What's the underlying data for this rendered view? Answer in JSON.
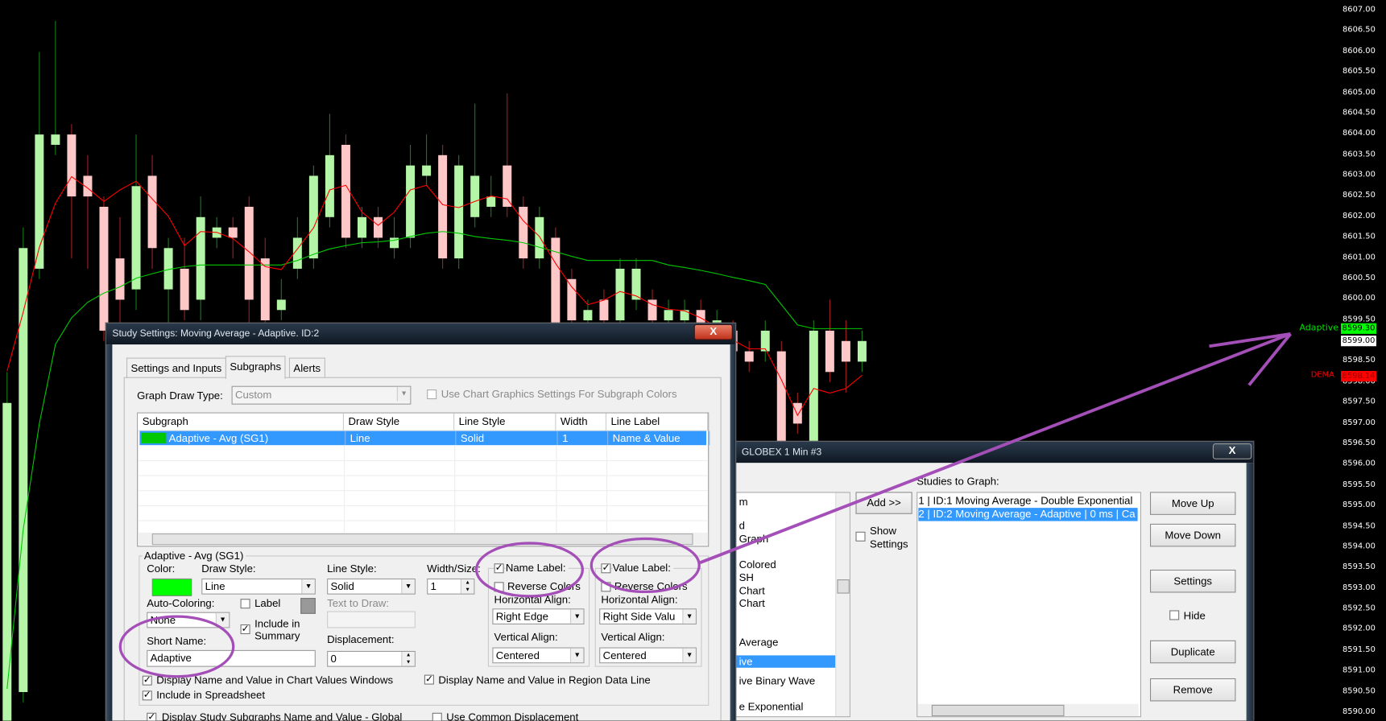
{
  "chart": {
    "price_ticks": [
      "8607.00",
      "8606.50",
      "8606.00",
      "8605.50",
      "8605.00",
      "8604.50",
      "8604.00",
      "8603.50",
      "8603.00",
      "8602.50",
      "8602.00",
      "8601.50",
      "8601.00",
      "8600.50",
      "8600.00",
      "8599.50",
      "8599.00",
      "8598.50",
      "8598.00",
      "8597.50",
      "8597.00",
      "8596.50",
      "8596.00",
      "8595.50",
      "8595.00",
      "8594.50",
      "8594.00",
      "8593.50",
      "8593.00",
      "8592.50",
      "8592.00",
      "8591.50",
      "8591.00",
      "8590.50",
      "8590.00"
    ],
    "colors": {
      "up": "#b4f5a8",
      "down": "#ffc8c8",
      "adaptive": "#00c800",
      "dema": "#ff0000",
      "annotation": "#a44fb8"
    },
    "candles": [
      [
        8589.75,
        8598.25,
        8589.5,
        8597.5
      ],
      [
        8590.5,
        8601.75,
        8590.25,
        8601.25
      ],
      [
        8600.75,
        8606,
        8600.5,
        8604
      ],
      [
        8603.75,
        8606.75,
        8603.5,
        8604
      ],
      [
        8604,
        8604.25,
        8601,
        8602.5
      ],
      [
        8603,
        8603.5,
        8600.75,
        8602.5
      ],
      [
        8602.25,
        8602.5,
        8599,
        8599.25
      ],
      [
        8601,
        8602,
        8599,
        8600
      ],
      [
        8600.25,
        8604,
        8599.75,
        8602.75
      ],
      [
        8603,
        8603.5,
        8600.75,
        8601.25
      ],
      [
        8600.25,
        8601.5,
        8598.75,
        8601.25
      ],
      [
        8600.75,
        8601.5,
        8599.5,
        8599.75
      ],
      [
        8600,
        8602.5,
        8599.5,
        8602
      ],
      [
        8601.5,
        8602,
        8601.25,
        8601.75
      ],
      [
        8601.75,
        8602,
        8601,
        8601.5
      ],
      [
        8602.25,
        8602.5,
        8599.25,
        8600
      ],
      [
        8601,
        8601.5,
        8599.25,
        8599.5
      ],
      [
        8599.75,
        8600.5,
        8599.5,
        8600
      ],
      [
        8600.75,
        8602,
        8600.5,
        8601.5
      ],
      [
        8601,
        8603.25,
        8600.75,
        8603
      ],
      [
        8602,
        8604.5,
        8601.75,
        8603.5
      ],
      [
        8603.75,
        8604,
        8601.25,
        8601.5
      ],
      [
        8601.5,
        8602.25,
        8601.25,
        8602
      ],
      [
        8602,
        8602.25,
        8601.25,
        8601.5
      ],
      [
        8601.25,
        8602,
        8601,
        8601.5
      ],
      [
        8601.5,
        8603.75,
        8601.25,
        8603.25
      ],
      [
        8603,
        8604,
        8602.75,
        8603.25
      ],
      [
        8603.5,
        8603.75,
        8600.75,
        8601
      ],
      [
        8601,
        8603.5,
        8600.75,
        8603.25
      ],
      [
        8602,
        8604.75,
        8601.75,
        8603
      ],
      [
        8602.25,
        8603,
        8602,
        8602.5
      ],
      [
        8603.25,
        8605,
        8602,
        8602.25
      ],
      [
        8602.25,
        8602.5,
        8600.75,
        8601
      ],
      [
        8601,
        8602.25,
        8600.75,
        8602
      ],
      [
        8601.5,
        8601.75,
        8599,
        8599.25
      ],
      [
        8600.5,
        8600.75,
        8599.25,
        8599.5
      ],
      [
        8599.5,
        8600,
        8599.25,
        8599.75
      ],
      [
        8600,
        8600.25,
        8599.25,
        8599.5
      ],
      [
        8599.5,
        8601,
        8599.25,
        8600.75
      ],
      [
        8600,
        8601,
        8599.75,
        8600.75
      ],
      [
        8600,
        8600.25,
        8599.25,
        8599.5
      ],
      [
        8599.5,
        8600,
        8599.25,
        8599.75
      ],
      [
        8599.5,
        8600,
        8599.25,
        8599.75
      ],
      [
        8599.75,
        8600,
        8599,
        8599.25
      ],
      [
        8599,
        8599.75,
        8598.75,
        8599.5
      ],
      [
        8599.25,
        8599.5,
        8598.5,
        8598.75
      ],
      [
        8598.75,
        8599,
        8598.25,
        8598.5
      ],
      [
        8598.75,
        8599.5,
        8598.5,
        8599.25
      ],
      [
        8598.75,
        8599,
        8596.25,
        8596.5
      ],
      [
        8597.5,
        8597.75,
        8596.75,
        8597
      ],
      [
        8596.5,
        8599.5,
        8596.25,
        8599.25
      ],
      [
        8599.25,
        8600,
        8598,
        8598.25
      ],
      [
        8599,
        8599.5,
        8597.75,
        8598.5
      ],
      [
        8598.5,
        8599.25,
        8598.25,
        8599
      ]
    ],
    "dema": [
      8598.27,
      8599.7,
      8601.27,
      8602.34,
      8602.98,
      8602.7,
      8602.38,
      8602.66,
      8602.87,
      8602.44,
      8602.02,
      8601.31,
      8601.65,
      8601.63,
      8601.48,
      8601.16,
      8600.8,
      8600.73,
      8601.23,
      8601.74,
      8602.66,
      8602.77,
      8602.12,
      8601.8,
      8602.12,
      8602.66,
      8602.77,
      8602.3,
      8602.23,
      8602.38,
      8602.51,
      8602.44,
      8601.91,
      8601.53,
      8600.88,
      8600.31,
      8599.88,
      8599.99,
      8600.2,
      8600.09,
      8599.88,
      8599.77,
      8599.73,
      8599.56,
      8599.34,
      8599.02,
      8598.81,
      8598.81,
      8598.06,
      8597.2,
      8597.85,
      8597.74,
      8597.85,
      8598.17
    ],
    "adaptive": [
      8590.58,
      8594.43,
      8597.0,
      8598.92,
      8599.56,
      8599.94,
      8600.16,
      8600.31,
      8600.52,
      8600.63,
      8600.73,
      8600.8,
      8600.84,
      8600.84,
      8600.84,
      8600.84,
      8600.84,
      8600.84,
      8600.95,
      8601.1,
      8601.23,
      8601.31,
      8601.38,
      8601.4,
      8601.44,
      8601.53,
      8601.61,
      8601.65,
      8601.61,
      8601.53,
      8601.48,
      8601.44,
      8601.38,
      8601.27,
      8601.16,
      8601.05,
      8600.95,
      8600.95,
      8600.95,
      8600.95,
      8600.95,
      8600.84,
      8600.78,
      8600.71,
      8600.63,
      8600.54,
      8600.46,
      8600.37,
      8599.88,
      8599.39,
      8599.3,
      8599.3,
      8599.3,
      8599.3
    ],
    "adaptive_label": "Adaptive",
    "adaptive_value": "8599.30",
    "last_price": "8599.00",
    "dema_label": "DEMA",
    "dema_value": "8598.14"
  },
  "study_dialog": {
    "title": "Study Settings: Moving Average - Adaptive. ID:2",
    "close": "X",
    "tabs": [
      "Settings and Inputs",
      "Subgraphs",
      "Alerts"
    ],
    "active_tab": "Subgraphs",
    "graph_draw_type_label": "Graph Draw Type:",
    "graph_draw_type": "Custom",
    "use_chart_graphics_label": "Use Chart Graphics Settings For Subgraph Colors",
    "use_chart_graphics": false,
    "columns": [
      "Subgraph",
      "Draw Style",
      "Line Style",
      "Width",
      "Line Label"
    ],
    "rows": [
      {
        "subgraph": "Adaptive - Avg (SG1)",
        "draw_style": "Line",
        "line_style": "Solid",
        "width": "1",
        "line_label": "Name & Value",
        "color": "#00c800"
      }
    ],
    "group_title": "Adaptive - Avg (SG1)",
    "color_label": "Color:",
    "color": "#00ff00",
    "draw_style_label": "Draw Style:",
    "draw_style": "Line",
    "line_style_label": "Line Style:",
    "line_style": "Solid",
    "width_label": "Width/Size:",
    "width": "1",
    "auto_coloring_label": "Auto-Coloring:",
    "auto_coloring": "None",
    "label_checkbox": "Label",
    "include_in_summary": "Include in Summary",
    "text_to_draw_label": "Text to Draw:",
    "short_name_label": "Short Name:",
    "short_name": "Adaptive",
    "displacement_label": "Displacement:",
    "displacement": "0",
    "name_label": {
      "title": "Name Label:",
      "checked": true,
      "reverse": "Reverse Colors",
      "h_label": "Horizontal Align:",
      "h": "Right Edge",
      "v_label": "Vertical Align:",
      "v": "Centered"
    },
    "value_label": {
      "title": "Value Label:",
      "checked": true,
      "reverse": "Reverse Colors",
      "h_label": "Horizontal Align:",
      "h": "Right Side Valu",
      "v_label": "Vertical Align:",
      "v": "Centered"
    },
    "display_chart_values": "Display Name and Value in Chart Values Windows",
    "display_region_data": "Display Name and Value in Region Data Line",
    "include_spreadsheet": "Include in Spreadsheet",
    "display_global": "Display Study Subgraphs Name and Value - Global",
    "use_common_displacement": "Use Common Displacement"
  },
  "studies_dialog": {
    "title": "GLOBEX  1 Min   #3",
    "close": "X",
    "available": [
      "m",
      "d",
      "Graph",
      "Colored",
      "SH",
      "Chart",
      " Chart",
      "Average",
      "ive",
      "ive Binary Wave",
      "e Exponential"
    ],
    "available_selected": "ive",
    "add": "Add >>",
    "show_settings": "Show Settings",
    "studies_label": "Studies to Graph:",
    "studies": [
      "1 | ID:1  Moving Average - Double Exponential",
      "2 | ID:2  Moving Average - Adaptive | 0 ms | Ca"
    ],
    "selected_index": 1,
    "move_up": "Move Up",
    "move_down": "Move Down",
    "settings": "Settings",
    "hide": "Hide",
    "duplicate": "Duplicate",
    "remove": "Remove"
  }
}
